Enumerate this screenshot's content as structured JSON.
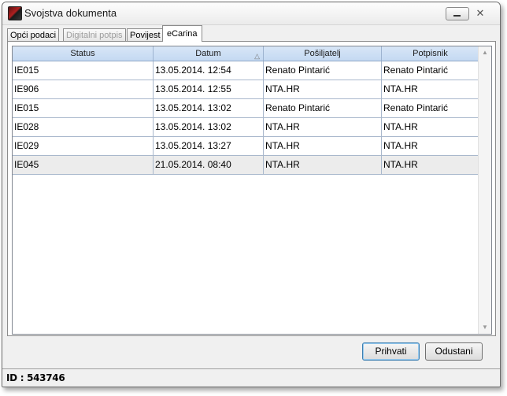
{
  "window": {
    "title": "Svojstva dokumenta",
    "minimize_icon": "minimize-icon",
    "close_icon": "close-x-icon"
  },
  "tabs": [
    {
      "label": "Opći podaci",
      "enabled": true,
      "active": false
    },
    {
      "label": "Digitalni potpis",
      "enabled": false,
      "active": false
    },
    {
      "label": "Povijest",
      "enabled": true,
      "active": false
    },
    {
      "label": "eCarina",
      "enabled": true,
      "active": true
    }
  ],
  "grid": {
    "columns": [
      "Status",
      "Datum",
      "Pošiljatelj",
      "Potpisnik"
    ],
    "sorted_column": "Datum",
    "sort_icon": "sort-ascending-icon",
    "rows": [
      [
        "IE015",
        "13.05.2014. 12:54",
        "Renato Pintarić",
        "Renato Pintarić"
      ],
      [
        "IE906",
        "13.05.2014. 12:55",
        "NTA.HR",
        "NTA.HR"
      ],
      [
        "IE015",
        "13.05.2014. 13:02",
        "Renato Pintarić",
        "Renato Pintarić"
      ],
      [
        "IE028",
        "13.05.2014. 13:02",
        "NTA.HR",
        "NTA.HR"
      ],
      [
        "IE029",
        "13.05.2014. 13:27",
        "NTA.HR",
        "NTA.HR"
      ],
      [
        "IE045",
        "21.05.2014. 08:40",
        "NTA.HR",
        "NTA.HR"
      ]
    ],
    "selected_row": 5
  },
  "buttons": {
    "accept": "Prihvati",
    "cancel": "Odustani"
  },
  "status": {
    "text": "ID : 543746"
  },
  "colors": {
    "header_bg": "#c9dcf3",
    "grid_line": "#a9b8cc",
    "selected_row": "#ececec",
    "default_button_border": "#3c7fb1"
  }
}
